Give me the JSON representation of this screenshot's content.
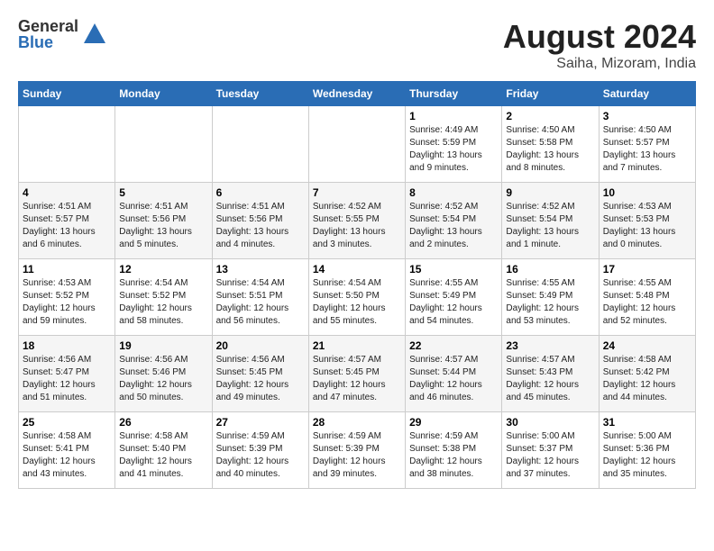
{
  "header": {
    "logo_general": "General",
    "logo_blue": "Blue",
    "month_year": "August 2024",
    "location": "Saiha, Mizoram, India"
  },
  "days_of_week": [
    "Sunday",
    "Monday",
    "Tuesday",
    "Wednesday",
    "Thursday",
    "Friday",
    "Saturday"
  ],
  "weeks": [
    [
      {
        "day": "",
        "info": ""
      },
      {
        "day": "",
        "info": ""
      },
      {
        "day": "",
        "info": ""
      },
      {
        "day": "",
        "info": ""
      },
      {
        "day": "1",
        "info": "Sunrise: 4:49 AM\nSunset: 5:59 PM\nDaylight: 13 hours and 9 minutes."
      },
      {
        "day": "2",
        "info": "Sunrise: 4:50 AM\nSunset: 5:58 PM\nDaylight: 13 hours and 8 minutes."
      },
      {
        "day": "3",
        "info": "Sunrise: 4:50 AM\nSunset: 5:57 PM\nDaylight: 13 hours and 7 minutes."
      }
    ],
    [
      {
        "day": "4",
        "info": "Sunrise: 4:51 AM\nSunset: 5:57 PM\nDaylight: 13 hours and 6 minutes."
      },
      {
        "day": "5",
        "info": "Sunrise: 4:51 AM\nSunset: 5:56 PM\nDaylight: 13 hours and 5 minutes."
      },
      {
        "day": "6",
        "info": "Sunrise: 4:51 AM\nSunset: 5:56 PM\nDaylight: 13 hours and 4 minutes."
      },
      {
        "day": "7",
        "info": "Sunrise: 4:52 AM\nSunset: 5:55 PM\nDaylight: 13 hours and 3 minutes."
      },
      {
        "day": "8",
        "info": "Sunrise: 4:52 AM\nSunset: 5:54 PM\nDaylight: 13 hours and 2 minutes."
      },
      {
        "day": "9",
        "info": "Sunrise: 4:52 AM\nSunset: 5:54 PM\nDaylight: 13 hours and 1 minute."
      },
      {
        "day": "10",
        "info": "Sunrise: 4:53 AM\nSunset: 5:53 PM\nDaylight: 13 hours and 0 minutes."
      }
    ],
    [
      {
        "day": "11",
        "info": "Sunrise: 4:53 AM\nSunset: 5:52 PM\nDaylight: 12 hours and 59 minutes."
      },
      {
        "day": "12",
        "info": "Sunrise: 4:54 AM\nSunset: 5:52 PM\nDaylight: 12 hours and 58 minutes."
      },
      {
        "day": "13",
        "info": "Sunrise: 4:54 AM\nSunset: 5:51 PM\nDaylight: 12 hours and 56 minutes."
      },
      {
        "day": "14",
        "info": "Sunrise: 4:54 AM\nSunset: 5:50 PM\nDaylight: 12 hours and 55 minutes."
      },
      {
        "day": "15",
        "info": "Sunrise: 4:55 AM\nSunset: 5:49 PM\nDaylight: 12 hours and 54 minutes."
      },
      {
        "day": "16",
        "info": "Sunrise: 4:55 AM\nSunset: 5:49 PM\nDaylight: 12 hours and 53 minutes."
      },
      {
        "day": "17",
        "info": "Sunrise: 4:55 AM\nSunset: 5:48 PM\nDaylight: 12 hours and 52 minutes."
      }
    ],
    [
      {
        "day": "18",
        "info": "Sunrise: 4:56 AM\nSunset: 5:47 PM\nDaylight: 12 hours and 51 minutes."
      },
      {
        "day": "19",
        "info": "Sunrise: 4:56 AM\nSunset: 5:46 PM\nDaylight: 12 hours and 50 minutes."
      },
      {
        "day": "20",
        "info": "Sunrise: 4:56 AM\nSunset: 5:45 PM\nDaylight: 12 hours and 49 minutes."
      },
      {
        "day": "21",
        "info": "Sunrise: 4:57 AM\nSunset: 5:45 PM\nDaylight: 12 hours and 47 minutes."
      },
      {
        "day": "22",
        "info": "Sunrise: 4:57 AM\nSunset: 5:44 PM\nDaylight: 12 hours and 46 minutes."
      },
      {
        "day": "23",
        "info": "Sunrise: 4:57 AM\nSunset: 5:43 PM\nDaylight: 12 hours and 45 minutes."
      },
      {
        "day": "24",
        "info": "Sunrise: 4:58 AM\nSunset: 5:42 PM\nDaylight: 12 hours and 44 minutes."
      }
    ],
    [
      {
        "day": "25",
        "info": "Sunrise: 4:58 AM\nSunset: 5:41 PM\nDaylight: 12 hours and 43 minutes."
      },
      {
        "day": "26",
        "info": "Sunrise: 4:58 AM\nSunset: 5:40 PM\nDaylight: 12 hours and 41 minutes."
      },
      {
        "day": "27",
        "info": "Sunrise: 4:59 AM\nSunset: 5:39 PM\nDaylight: 12 hours and 40 minutes."
      },
      {
        "day": "28",
        "info": "Sunrise: 4:59 AM\nSunset: 5:39 PM\nDaylight: 12 hours and 39 minutes."
      },
      {
        "day": "29",
        "info": "Sunrise: 4:59 AM\nSunset: 5:38 PM\nDaylight: 12 hours and 38 minutes."
      },
      {
        "day": "30",
        "info": "Sunrise: 5:00 AM\nSunset: 5:37 PM\nDaylight: 12 hours and 37 minutes."
      },
      {
        "day": "31",
        "info": "Sunrise: 5:00 AM\nSunset: 5:36 PM\nDaylight: 12 hours and 35 minutes."
      }
    ]
  ]
}
